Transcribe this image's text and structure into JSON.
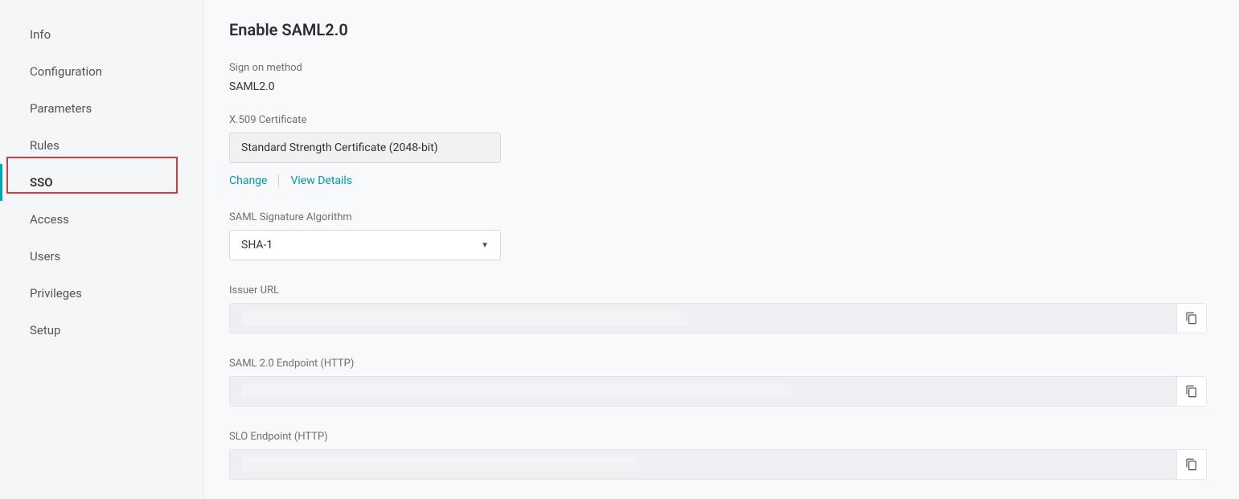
{
  "sidebar": {
    "items": [
      {
        "label": "Info"
      },
      {
        "label": "Configuration"
      },
      {
        "label": "Parameters"
      },
      {
        "label": "Rules"
      },
      {
        "label": "SSO",
        "active": true
      },
      {
        "label": "Access"
      },
      {
        "label": "Users"
      },
      {
        "label": "Privileges"
      },
      {
        "label": "Setup"
      }
    ]
  },
  "page": {
    "title": "Enable SAML2.0",
    "signOnMethod": {
      "label": "Sign on method",
      "value": "SAML2.0"
    },
    "certificate": {
      "label": "X.509 Certificate",
      "value": "Standard Strength Certificate (2048-bit)",
      "changeLink": "Change",
      "viewDetailsLink": "View Details"
    },
    "signatureAlgorithm": {
      "label": "SAML Signature Algorithm",
      "value": "SHA-1"
    },
    "issuerUrl": {
      "label": "Issuer URL",
      "value": ""
    },
    "samlEndpoint": {
      "label": "SAML 2.0 Endpoint (HTTP)",
      "value": ""
    },
    "sloEndpoint": {
      "label": "SLO Endpoint (HTTP)",
      "value": ""
    }
  }
}
